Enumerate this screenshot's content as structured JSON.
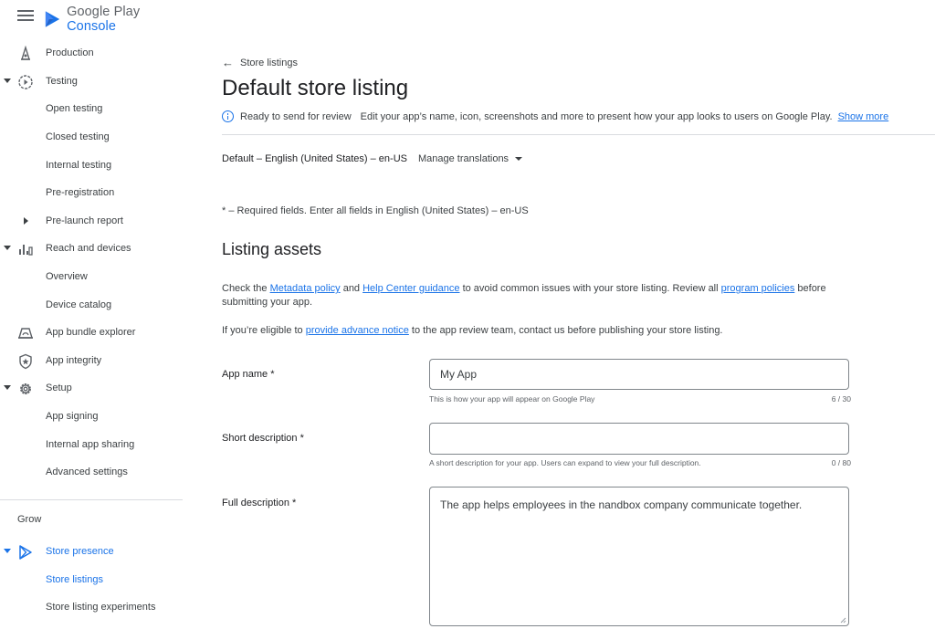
{
  "header": {
    "logo_text_1": "Google Play",
    "logo_text_2": "Console",
    "menu_icon": "hamburger-menu-icon"
  },
  "sidebar": {
    "items": [
      {
        "label": "Production",
        "icon": "production-icon"
      },
      {
        "label": "Testing",
        "icon": "testing-icon"
      },
      {
        "label": "Open testing"
      },
      {
        "label": "Closed testing"
      },
      {
        "label": "Internal testing"
      },
      {
        "label": "Pre-registration"
      },
      {
        "label": "Pre-launch report"
      },
      {
        "label": "Reach and devices",
        "icon": "bar-chart-icon"
      },
      {
        "label": "Overview"
      },
      {
        "label": "Device catalog"
      },
      {
        "label": "App bundle explorer",
        "icon": "app-bundle-icon"
      },
      {
        "label": "App integrity",
        "icon": "shield-icon"
      },
      {
        "label": "Setup",
        "icon": "gear-icon"
      },
      {
        "label": "App signing"
      },
      {
        "label": "Internal app sharing"
      },
      {
        "label": "Advanced settings"
      },
      {
        "label": "Store presence",
        "icon": "play-icon"
      },
      {
        "label": "Store listings"
      },
      {
        "label": "Store listing experiments"
      }
    ],
    "section_grow": "Grow",
    "accent_color": "#1a73e8"
  },
  "main": {
    "back_link": "Store listings",
    "title": "Default store listing",
    "status": {
      "text": "Ready to send for review",
      "description": "Edit your app’s name, icon, screenshots and more to present how your app looks to users on Google Play.",
      "show_more": "Show more"
    },
    "language": "Default – English (United States) – en-US",
    "manage_translations": "Manage translations",
    "required_note": "* – Required fields. Enter all fields in English (United States) – en-US",
    "section_title": "Listing assets",
    "policy_text": {
      "p1": "Check the ",
      "link1": "Metadata policy",
      "p2": " and ",
      "link2": "Help Center guidance",
      "p3": " to avoid common issues with your store listing. Review all ",
      "link3": "program policies",
      "p4": " before submitting your app."
    },
    "notice_text": {
      "p1": "If you’re eligible to ",
      "link": "provide advance notice",
      "p2": " to the app review team, contact us before publishing your store listing."
    },
    "fields": {
      "app_name": {
        "label": "App name  *",
        "value": "My App",
        "hint": "This is how your app will appear on Google Play",
        "counter": "6 / 30"
      },
      "short_description": {
        "label": "Short description  *",
        "value": "",
        "hint": "A short description for your app. Users can expand to view your full description.",
        "counter": "0 / 80"
      },
      "full_description": {
        "label": "Full description  *",
        "value": "The app helps employees in the nandbox company communicate together."
      }
    }
  }
}
